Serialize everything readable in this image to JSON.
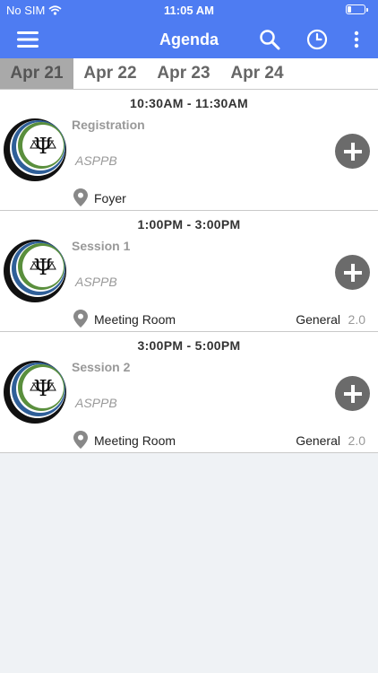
{
  "status_bar": {
    "carrier": "No SIM",
    "time": "11:05 AM"
  },
  "navbar": {
    "title": "Agenda"
  },
  "tabs": [
    {
      "label": "Apr 21",
      "active": true
    },
    {
      "label": "Apr 22",
      "active": false
    },
    {
      "label": "Apr 23",
      "active": false
    },
    {
      "label": "Apr 24",
      "active": false
    }
  ],
  "sessions": [
    {
      "time": "10:30AM - 11:30AM",
      "name": "Registration",
      "organizer": "ASPPB",
      "location": "Foyer",
      "track": "",
      "credits": ""
    },
    {
      "time": "1:00PM - 3:00PM",
      "name": "Session 1",
      "organizer": "ASPPB",
      "location": "Meeting Room",
      "track": "General",
      "credits": "2.0"
    },
    {
      "time": "3:00PM - 5:00PM",
      "name": "Session 2",
      "organizer": "ASPPB",
      "location": "Meeting Room",
      "track": "General",
      "credits": "2.0"
    }
  ],
  "icons": {
    "menu": "hamburger-menu-icon",
    "search": "search-icon",
    "clock": "clock-icon",
    "more": "more-vertical-icon",
    "add": "plus-icon",
    "location": "location-pin-icon"
  },
  "colors": {
    "header": "#4e7cf2",
    "active_tab": "#a9a9a9",
    "add_button": "#6b6b6b"
  }
}
